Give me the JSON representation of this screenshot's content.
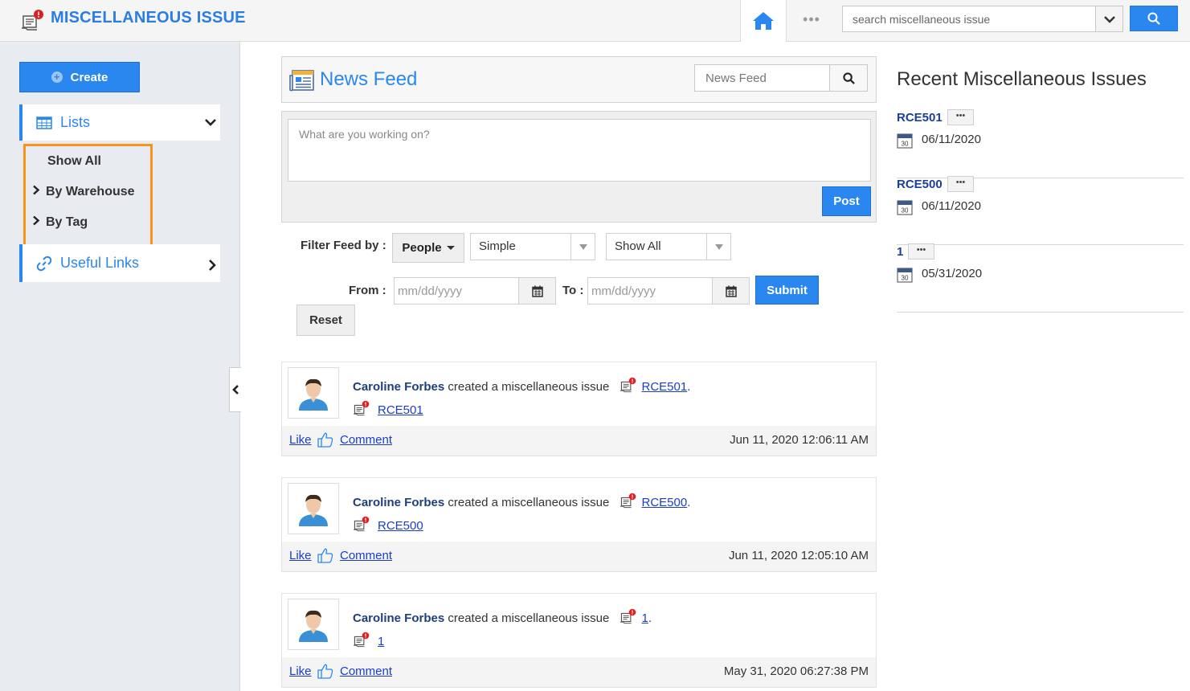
{
  "app": {
    "title": "MISCELLANEOUS ISSUE"
  },
  "topbar": {
    "search_placeholder": "search miscellaneous issue",
    "more_label": "•••"
  },
  "sidebar": {
    "create_label": "Create",
    "lists_label": "Lists",
    "lists_items": [
      "Show All",
      "By Warehouse",
      "By Tag"
    ],
    "useful_links_label": "Useful Links"
  },
  "news_feed": {
    "title": "News Feed",
    "search_placeholder": "News Feed",
    "post_placeholder": "What are you working on?",
    "post_label": "Post",
    "filter_label": "Filter Feed by :",
    "people_label": "People",
    "type_select": "Simple",
    "show_select": "Show All",
    "from_label": "From :",
    "to_label": "To :",
    "date_placeholder": "mm/dd/yyyy",
    "submit_label": "Submit",
    "reset_label": "Reset",
    "items": [
      {
        "user": "Caroline Forbes",
        "action": "created a miscellaneous issue",
        "ref": "RCE501",
        "like": "Like",
        "comment": "Comment",
        "time": "Jun 11, 2020 12:06:11 AM"
      },
      {
        "user": "Caroline Forbes",
        "action": "created a miscellaneous issue",
        "ref": "RCE500",
        "like": "Like",
        "comment": "Comment",
        "time": "Jun 11, 2020 12:05:10 AM"
      },
      {
        "user": "Caroline Forbes",
        "action": "created a miscellaneous issue",
        "ref": "1",
        "like": "Like",
        "comment": "Comment",
        "time": "May 31, 2020 06:27:38 PM"
      }
    ]
  },
  "recent": {
    "title": "Recent Miscellaneous Issues",
    "more_label": "•••",
    "calendar_day": "30",
    "items": [
      {
        "name": "RCE501",
        "date": "06/11/2020"
      },
      {
        "name": "RCE500",
        "date": "06/11/2020"
      },
      {
        "name": "1",
        "date": "05/31/2020"
      }
    ]
  },
  "colors": {
    "accent": "#2b87f0",
    "highlight_border": "#f7941d",
    "link": "#1a3ecb"
  }
}
